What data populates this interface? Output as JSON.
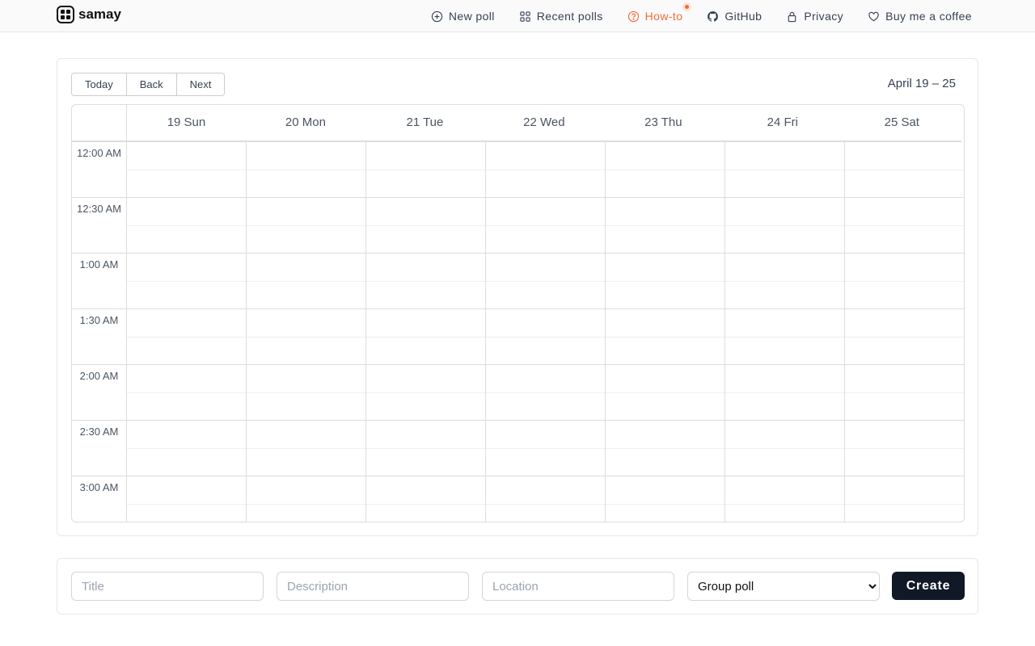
{
  "brand": "samay",
  "nav": [
    {
      "label": "New poll",
      "icon": "plus-circle-icon"
    },
    {
      "label": "Recent polls",
      "icon": "grid-icon"
    },
    {
      "label": "How-to",
      "icon": "question-circle-icon",
      "active": true
    },
    {
      "label": "GitHub",
      "icon": "github-icon"
    },
    {
      "label": "Privacy",
      "icon": "lock-icon"
    },
    {
      "label": "Buy me a coffee",
      "icon": "heart-icon"
    }
  ],
  "toolbar": {
    "today": "Today",
    "back": "Back",
    "next": "Next",
    "range": "April 19 – 25"
  },
  "days": [
    "19 Sun",
    "20 Mon",
    "21 Tue",
    "22 Wed",
    "23 Thu",
    "24 Fri",
    "25 Sat"
  ],
  "times": [
    "12:00 AM",
    "12:30 AM",
    "1:00 AM",
    "1:30 AM",
    "2:00 AM",
    "2:30 AM",
    "3:00 AM"
  ],
  "form": {
    "title_placeholder": "Title",
    "description_placeholder": "Description",
    "location_placeholder": "Location",
    "poll_type": "Group poll",
    "create": "Create"
  },
  "colors": {
    "accent": "#f26b3a",
    "button": "#111827"
  }
}
